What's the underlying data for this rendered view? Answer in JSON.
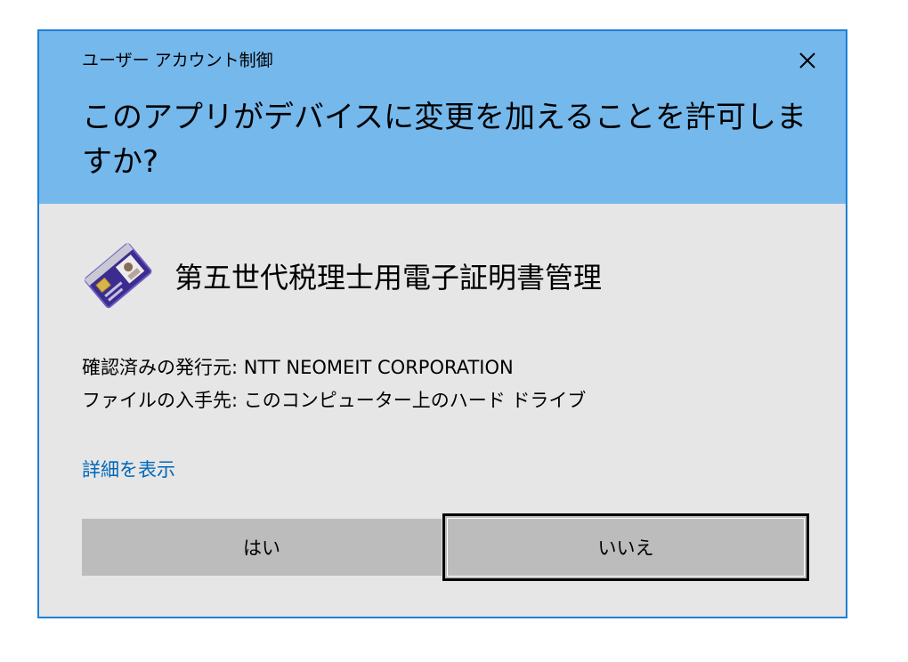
{
  "dialog": {
    "window_title": "ユーザー アカウント制御",
    "question": "このアプリがデバイスに変更を加えることを許可しますか?",
    "close_icon": "close-icon",
    "app": {
      "icon": "smart-card-icon",
      "name": "第五世代税理士用電子証明書管理"
    },
    "publisher_line": "確認済みの発行元: NTT NEOMEIT CORPORATION",
    "origin_line": "ファイルの入手先: このコンピューター上のハード ドライブ",
    "details_link": "詳細を表示",
    "yes_label": "はい",
    "no_label": "いいえ",
    "colors": {
      "header": "#75b8ec",
      "body": "#e6e6e6",
      "border": "#1e7fd6",
      "link": "#0067b8",
      "button": "#bcbcbc"
    }
  }
}
